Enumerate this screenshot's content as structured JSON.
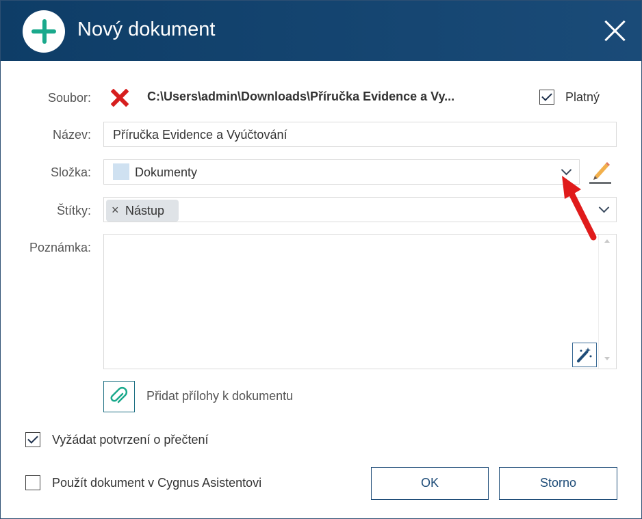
{
  "dialog": {
    "title": "Nový dokument",
    "colors": {
      "titlebar": "#0e3d67",
      "plus_icon": "#1aa98c",
      "error": "#d61e1e",
      "button_border": "#1e4c78",
      "annotation_arrow": "#e01b1b"
    },
    "icons": {
      "title": "plus-circle-icon",
      "close": "close-icon",
      "file_status": "red-x-icon",
      "edit": "pencil-icon",
      "magic": "magic-wand-icon",
      "attach": "paperclip-icon"
    }
  },
  "form": {
    "file": {
      "label": "Soubor:",
      "path": "C:\\Users\\admin\\Downloads\\Příručka Evidence a Vy..."
    },
    "valid": {
      "label": "Platný",
      "checked": true
    },
    "name": {
      "label": "Název:",
      "value": "Příručka Evidence a Vyúčtování"
    },
    "folder": {
      "label": "Složka:",
      "value": "Dokumenty"
    },
    "tags": {
      "label": "Štítky:",
      "items": [
        {
          "remove": "×",
          "label": "Nástup"
        }
      ]
    },
    "note": {
      "label": "Poznámka:",
      "value": ""
    },
    "attachments": {
      "label": "Přidat přílohy k dokumentu"
    },
    "request_read": {
      "label": "Vyžádat potvrzení o přečtení",
      "checked": true
    },
    "use_assistant": {
      "label": "Použít dokument v Cygnus Asistentovi",
      "checked": false
    }
  },
  "buttons": {
    "ok": "OK",
    "cancel": "Storno"
  }
}
